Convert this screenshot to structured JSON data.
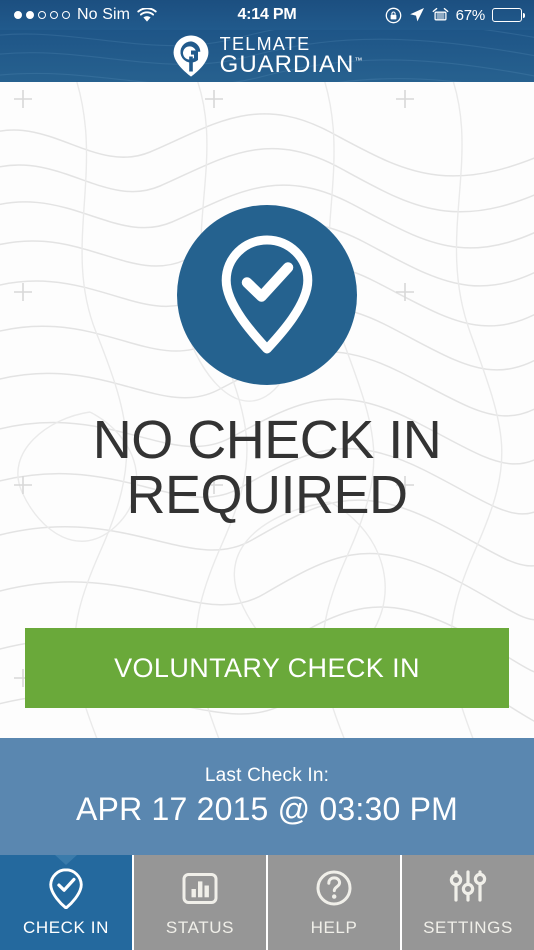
{
  "status_bar": {
    "signal_dots_filled": 2,
    "signal_dots_total": 5,
    "carrier": "No Sim",
    "wifi_icon": "wifi-icon",
    "time": "4:14 PM",
    "rotation_lock_icon": "rotation-lock-icon",
    "location_icon": "location-arrow-icon",
    "alarm_icon": "alarm-clock-icon",
    "battery_percent": "67%",
    "battery_fill_ratio": 0.65
  },
  "header": {
    "logo_icon": "telmate-pin-logo-icon",
    "brand_line1": "TELMATE",
    "brand_line2": "GUARDIAN",
    "trademark": "™",
    "background_color": "#215a8c"
  },
  "main": {
    "hero_icon": "map-pin-check-icon",
    "hero_icon_bg_color": "#25628f",
    "title_line1": "NO CHECK IN",
    "title_line2": "REQUIRED",
    "title_color": "#333333",
    "cta_label": "VOLUNTARY CHECK IN",
    "cta_color": "#6aa93a",
    "background_pattern": "topographic-contour-map"
  },
  "last_check_in": {
    "label": "Last Check In:",
    "value": "APR 17 2015 @ 03:30 PM",
    "background_color": "#5a87b0"
  },
  "tabbar": {
    "active_index": 0,
    "active_color": "#24699e",
    "inactive_color": "#969696",
    "tabs": [
      {
        "label": "CHECK IN",
        "icon": "map-pin-check-icon"
      },
      {
        "label": "STATUS",
        "icon": "bar-chart-icon"
      },
      {
        "label": "HELP",
        "icon": "question-circle-icon"
      },
      {
        "label": "SETTINGS",
        "icon": "sliders-icon"
      }
    ]
  }
}
